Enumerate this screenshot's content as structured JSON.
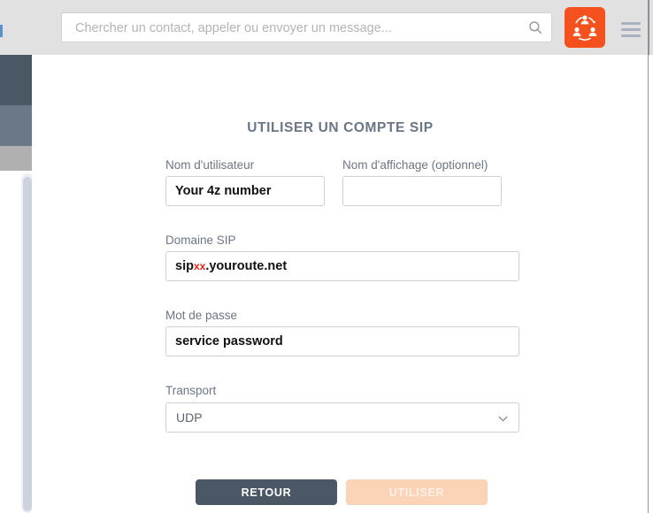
{
  "topbar": {
    "search": {
      "placeholder": "Chercher un contact, appeler ou envoyer un message...",
      "value": "",
      "icon": "search-icon"
    },
    "conference_button": {
      "icon": "conference-group-icon",
      "color": "#f4511e"
    },
    "menu_button": {
      "icon": "hamburger-menu-icon"
    },
    "background": "#e1e1e1"
  },
  "panel": {
    "title": "UTILISER UN COMPTE SIP",
    "title_color": "#6a7585",
    "fields": {
      "username": {
        "label": "Nom d'utilisateur",
        "value": "Your 4z number",
        "placeholder": ""
      },
      "display_name": {
        "label": "Nom d'affichage (optionnel)",
        "value": "",
        "placeholder": ""
      },
      "sip_domain": {
        "label": "Domaine SIP",
        "prefix": "sip",
        "accent": "xx",
        "accent_color": "#e8230f",
        "suffix": ".youroute.net"
      },
      "password": {
        "label": "Mot de passe",
        "value": "service password",
        "placeholder": ""
      },
      "transport": {
        "label": "Transport",
        "value": "UDP",
        "icon": "chevron-down-icon"
      }
    },
    "buttons": {
      "back": {
        "label": "RETOUR",
        "color": "#4c5765",
        "text_color": "#ffffff"
      },
      "submit": {
        "label": "UTILISER",
        "color": "#fbd3b7",
        "text_color": "#fdf0e6",
        "state": "disabled"
      }
    }
  },
  "left_strip": {
    "blocks": [
      {
        "name": "conversation-item-active",
        "color": "#4a5765"
      },
      {
        "name": "conversation-item",
        "color": "#6b7888"
      },
      {
        "name": "conversation-item-muted",
        "color": "#b0b0b0"
      }
    ],
    "scrollbar": {
      "track": "#eceff3",
      "thumb": "#ccd3dc"
    }
  }
}
